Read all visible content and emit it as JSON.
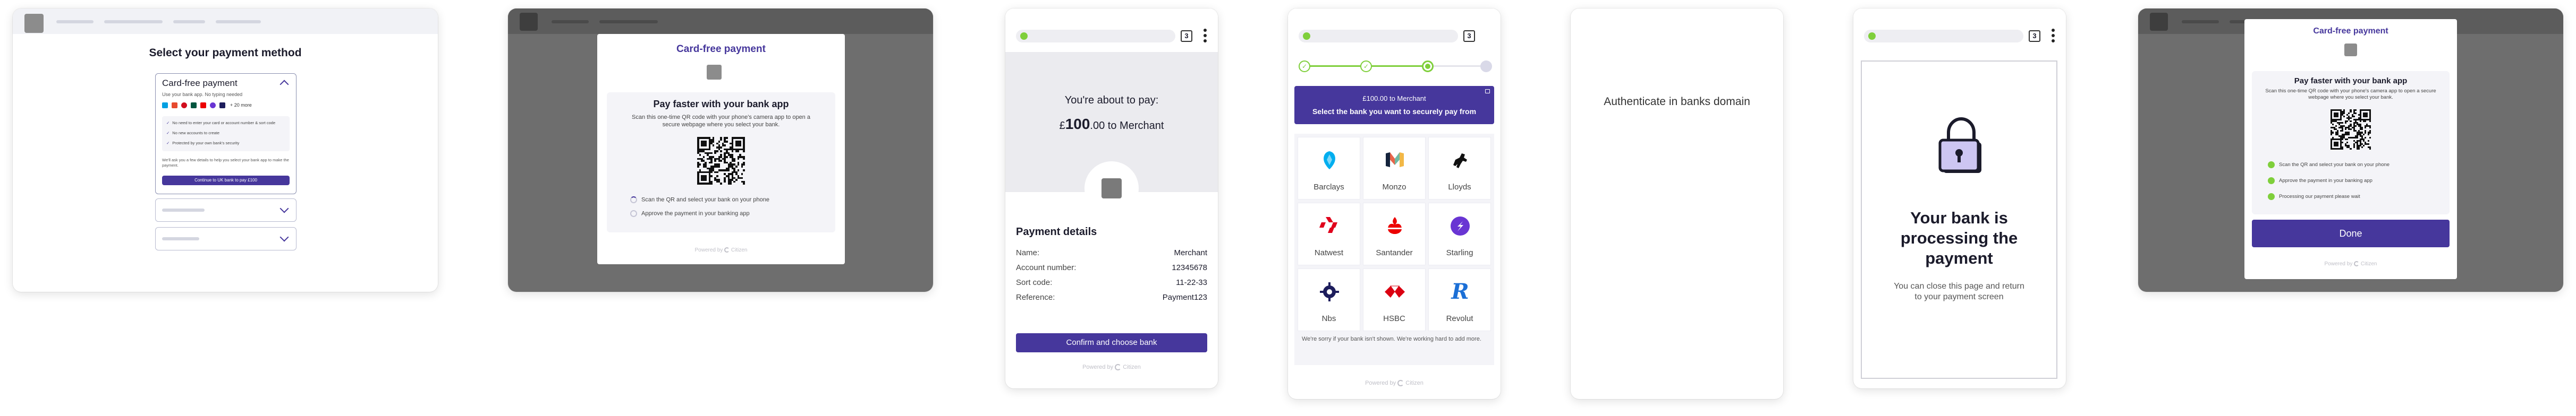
{
  "panel1": {
    "heading": "Select your payment method",
    "option_title": "Card-free payment",
    "option_subtitle": "Use your bank app. No typing needed",
    "more_label": "+ 20 more",
    "benefits": [
      "No need to enter your card or account number & sort code",
      "No new accounts to create",
      "Protected by your own bank's security"
    ],
    "footnote_a": "We'll ask you a few details to help you select your bank app to make the payment.",
    "footnote_link": "bank app",
    "cta": "Continue to UK bank to pay £100"
  },
  "panel2": {
    "title": "Card-free payment",
    "heading": "Pay faster with your bank app",
    "body": "Scan this one-time QR code with your phone's camera app to open a secure webpage where you select your bank.",
    "steps": [
      "Scan the QR and select your bank on your phone",
      "Approve the payment in your banking app"
    ],
    "powered": "Powered by",
    "brand": "Citizen"
  },
  "panel3": {
    "tab_count": "3",
    "pay_label": "You're about to pay:",
    "currency": "£",
    "amount_major": "100",
    "amount_minor": ".00",
    "to_merchant": "to Merchant",
    "details_title": "Payment details",
    "rows": [
      {
        "label": "Name:",
        "value": "Merchant"
      },
      {
        "label": "Account number:",
        "value": "12345678"
      },
      {
        "label": "Sort code:",
        "value": "11-22-33"
      },
      {
        "label": "Reference:",
        "value": "Payment123"
      }
    ],
    "cta": "Confirm and choose bank",
    "powered": "Powered by",
    "brand": "Citizen"
  },
  "panel4": {
    "tab_count": "3",
    "banner_line1": "£100.00 to Merchant",
    "banner_line2": "Select the bank you want to securely pay from",
    "banks": [
      "Barclays",
      "Monzo",
      "Lloyds",
      "Natwest",
      "Santander",
      "Starling",
      "Nbs",
      "HSBC",
      "Revolut"
    ],
    "sorry": "We're sorry if your bank isn't shown. We're working hard to add more.",
    "powered": "Powered by",
    "brand": "Citizen"
  },
  "panel5": {
    "text": "Authenticate in banks domain"
  },
  "panel6": {
    "tab_count": "3",
    "heading": "Your bank is processing the payment",
    "body": "You can close this page and return to your payment screen"
  },
  "panel7": {
    "title": "Card-free payment",
    "heading": "Pay faster with your bank app",
    "body": "Scan this one-time QR code with your phone's camera app to open a secure webpage where you select your bank.",
    "steps": [
      "Scan the QR and select your bank on your phone",
      "Approve the payment in your banking app",
      "Processing our payment please wait"
    ],
    "cta": "Done",
    "powered": "Powered by",
    "brand": "Citizen"
  },
  "colors": {
    "brand_purple": "#46379c",
    "success_green": "#7fcf3b",
    "overlay_grey": "#6e6e6e"
  }
}
